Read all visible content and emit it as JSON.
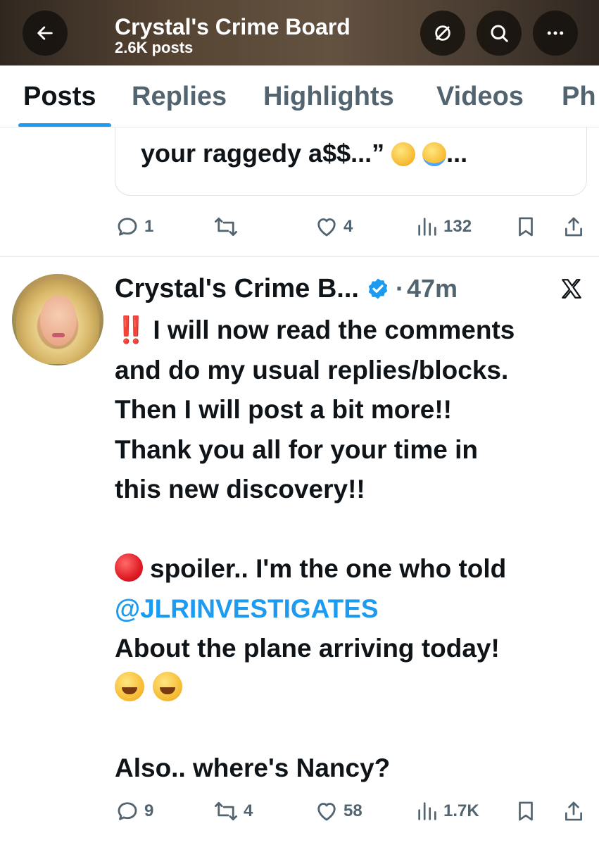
{
  "header": {
    "title": "Crystal's Crime Board",
    "subtitle": "2.6K posts"
  },
  "icons": {
    "back": "arrow-left-icon",
    "spaces": "circle-slash-icon",
    "search": "search-icon",
    "more": "more-horizontal-icon"
  },
  "tabs": [
    {
      "label": "Posts",
      "active": true
    },
    {
      "label": "Replies",
      "active": false
    },
    {
      "label": "Highlights",
      "active": false
    },
    {
      "label": "Videos",
      "active": false
    },
    {
      "label": "Ph",
      "active": false
    }
  ],
  "previous_post": {
    "quote_text": "your raggedy a$$...”",
    "quote_suffix": "...",
    "actions": {
      "replies": "1",
      "reposts": "",
      "likes": "4",
      "views": "132"
    }
  },
  "post": {
    "author": "Crystal's Crime B...",
    "separator": "·",
    "time": "47m",
    "body_lines": [
      "I will now read the comments",
      "and do my usual replies/blocks.",
      "Then I will post a bit more!!",
      "Thank you all for your time in",
      "this new discovery!!"
    ],
    "bangs": "‼️",
    "spoiler_line": "spoiler.. I'm the one who told",
    "mention": "@JLRINVESTIGATES",
    "after_mention": "About the plane arriving today!",
    "closing": "Also.. where's Nancy?",
    "actions": {
      "replies": "9",
      "reposts": "4",
      "likes": "58",
      "views": "1.7K"
    }
  },
  "colors": {
    "accent": "#1d9bf0",
    "text": "#0f1419",
    "muted": "#536471"
  }
}
